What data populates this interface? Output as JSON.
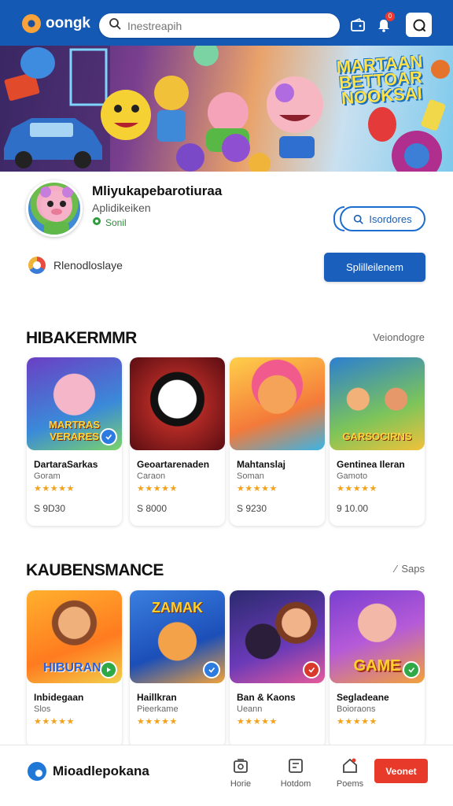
{
  "header": {
    "logo_text": "oongk",
    "search_placeholder": "Inestreapih",
    "notification_count": "0"
  },
  "hero": {
    "title": "MARTAAN BETTOAR NOOKSAI"
  },
  "profile": {
    "name": "Mliyukapebarotiuraa",
    "subtitle": "Aplidikeiken",
    "status": "Sonil",
    "outline_button": "Isordores",
    "sub_text": "Rlenodloslaye",
    "primary_button": "Splilleilenem"
  },
  "section1": {
    "title": "HIBAKERMMR",
    "link": "Veiondogre",
    "cards": [
      {
        "title": "DartaraSarkas",
        "category": "Goram",
        "stars": "★★★★★",
        "price": "S 9D30",
        "img_label": "MARTRAS VERARES"
      },
      {
        "title": "Geoartarenaden",
        "category": "Caraon",
        "stars": "★★★★★",
        "price": "S 8000",
        "img_label": ""
      },
      {
        "title": "Mahtanslaj",
        "category": "Soman",
        "stars": "★★★★★",
        "price": "S 9230",
        "img_label": ""
      },
      {
        "title": "Gentinea Ileran",
        "category": "Gamoto",
        "stars": "★★★★★",
        "price": "9 10.00",
        "img_label": "GARSOCIRNS"
      }
    ]
  },
  "section2": {
    "title": "KAUBENSMANCE",
    "link": "Saps",
    "cards": [
      {
        "title": "Inbidegaan",
        "category": "Slos",
        "stars": "★★★★★",
        "img_label": "HIBURAN!"
      },
      {
        "title": "Haillkran",
        "category": "Pieerkame",
        "stars": "★★★★★",
        "img_label": "ZAMAK"
      },
      {
        "title": "Ban & Kaons",
        "category": "Ueann",
        "stars": "★★★★★",
        "img_label": ""
      },
      {
        "title": "Segladeane",
        "category": "Boioraons",
        "stars": "★★★★★",
        "img_label": "GAME"
      }
    ]
  },
  "bottom_nav": {
    "brand": "Mioadlepokana",
    "items": [
      {
        "label": "Horie",
        "icon": "home-icon"
      },
      {
        "label": "Hotdom",
        "icon": "grid-icon"
      },
      {
        "label": "Poems",
        "icon": "house-icon"
      }
    ],
    "cta": "Veonet"
  }
}
